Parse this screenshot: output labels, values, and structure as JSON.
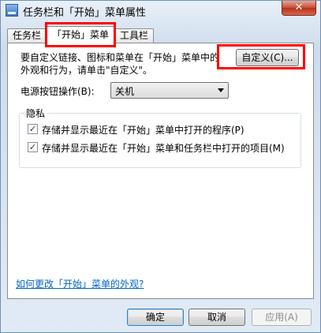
{
  "window": {
    "title": "任务栏和「开始」菜单属性",
    "close_label": "✕"
  },
  "tabs": [
    {
      "label": "任务栏"
    },
    {
      "label": "「开始」菜单"
    },
    {
      "label": "工具栏"
    }
  ],
  "start_tab": {
    "description_line1": "要自定义链接、图标和菜单在「开始」菜单中的",
    "description_line2": "外观和行为，请单击\"自定义\"。",
    "customize_button": "自定义(C)...",
    "power_label": "电源按钮操作(B):",
    "power_value": "关机",
    "privacy": {
      "title": "隐私",
      "items": [
        {
          "label": "存储并显示最近在「开始」菜单中打开的程序(P)",
          "checked": true
        },
        {
          "label": "存储并显示最近在「开始」菜单和任务栏中打开的项目(M)",
          "checked": true
        }
      ]
    },
    "help_link": "如何更改「开始」菜单的外观?"
  },
  "footer": {
    "ok": "确定",
    "cancel": "取消",
    "apply": "应用(A)"
  },
  "colors": {
    "highlight": "#ff0000",
    "link": "#0066cc"
  }
}
